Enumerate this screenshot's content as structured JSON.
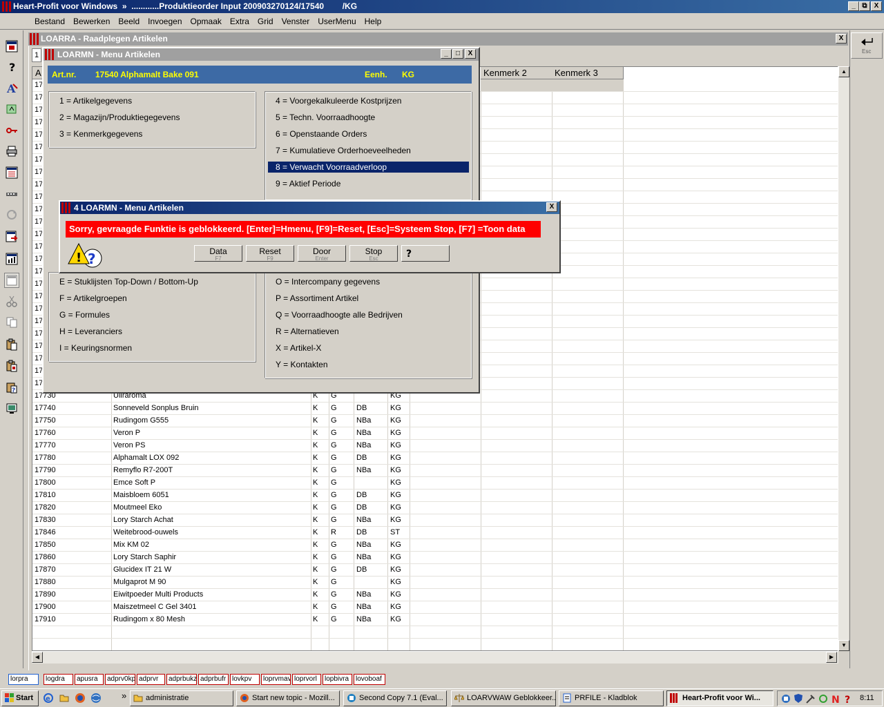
{
  "app": {
    "title": "Heart-Profit voor Windows  »  ............Produktieorder Input 200903270124/17540        /KG",
    "controls": [
      "_",
      "⧉",
      "X"
    ]
  },
  "menubar": [
    "Bestand",
    "Bewerken",
    "Beeld",
    "Invoegen",
    "Opmaak",
    "Extra",
    "Grid",
    "Venster",
    "UserMenu",
    "Help"
  ],
  "esc_label": "Esc",
  "loarra": {
    "title": "LOARRA - Raadplegen Artikelen",
    "close": "X",
    "tab_partial": "1"
  },
  "grid": {
    "columns": [
      {
        "label": "A"
      },
      {
        "label": "Kenmerk 2"
      },
      {
        "label": "Kenmerk 3"
      }
    ],
    "partial_rows": [
      "17",
      "17",
      "17",
      "17",
      "17",
      "17",
      "17",
      "17",
      "17",
      "17",
      "17",
      "17",
      "17",
      "17",
      "17",
      "17",
      "17",
      "17",
      "17",
      "17",
      "17",
      "17",
      "17",
      "17",
      "17"
    ],
    "rows": [
      {
        "code": "17730",
        "desc": "Uliraroma",
        "c1": "K",
        "c2": "G",
        "c3": "",
        "unit": "KG"
      },
      {
        "code": "17740",
        "desc": "Sonneveld Sonplus Bruin",
        "c1": "K",
        "c2": "G",
        "c3": "DB",
        "unit": "KG"
      },
      {
        "code": "17750",
        "desc": "Rudingom G555",
        "c1": "K",
        "c2": "G",
        "c3": "NBa",
        "unit": "KG"
      },
      {
        "code": "17760",
        "desc": "Veron P",
        "c1": "K",
        "c2": "G",
        "c3": "NBa",
        "unit": "KG"
      },
      {
        "code": "17770",
        "desc": "Veron PS",
        "c1": "K",
        "c2": "G",
        "c3": "NBa",
        "unit": "KG"
      },
      {
        "code": "17780",
        "desc": "Alphamalt LOX 092",
        "c1": "K",
        "c2": "G",
        "c3": "DB",
        "unit": "KG"
      },
      {
        "code": "17790",
        "desc": "Remyflo R7-200T",
        "c1": "K",
        "c2": "G",
        "c3": "NBa",
        "unit": "KG"
      },
      {
        "code": "17800",
        "desc": "Emce Soft P",
        "c1": "K",
        "c2": "G",
        "c3": "",
        "unit": "KG"
      },
      {
        "code": "17810",
        "desc": "Maisbloem  6051",
        "c1": "K",
        "c2": "G",
        "c3": "DB",
        "unit": "KG"
      },
      {
        "code": "17820",
        "desc": "Moutmeel Eko",
        "c1": "K",
        "c2": "G",
        "c3": "DB",
        "unit": "KG"
      },
      {
        "code": "17830",
        "desc": "Lory Starch Achat",
        "c1": "K",
        "c2": "G",
        "c3": "NBa",
        "unit": "KG"
      },
      {
        "code": "17846",
        "desc": "Weitebrood-ouwels",
        "c1": "K",
        "c2": "R",
        "c3": "DB",
        "unit": "ST"
      },
      {
        "code": "17850",
        "desc": "Mix KM 02",
        "c1": "K",
        "c2": "G",
        "c3": "NBa",
        "unit": "KG"
      },
      {
        "code": "17860",
        "desc": "Lory Starch Saphir",
        "c1": "K",
        "c2": "G",
        "c3": "NBa",
        "unit": "KG"
      },
      {
        "code": "17870",
        "desc": "Glucidex IT 21 W",
        "c1": "K",
        "c2": "G",
        "c3": "DB",
        "unit": "KG"
      },
      {
        "code": "17880",
        "desc": "Mulgaprot M 90",
        "c1": "K",
        "c2": "G",
        "c3": "",
        "unit": "KG"
      },
      {
        "code": "17890",
        "desc": "Eiwitpoeder Multi Products",
        "c1": "K",
        "c2": "G",
        "c3": "NBa",
        "unit": "KG"
      },
      {
        "code": "17900",
        "desc": "Maiszetmeel C Gel 3401",
        "c1": "K",
        "c2": "G",
        "c3": "NBa",
        "unit": "KG"
      },
      {
        "code": "17910",
        "desc": "Rudingom  x 80 Mesh",
        "c1": "K",
        "c2": "G",
        "c3": "NBa",
        "unit": "KG"
      }
    ]
  },
  "menu_artikelen": {
    "title": "LOARMN - Menu Artikelen",
    "controls": [
      "_",
      "□",
      "X"
    ],
    "art_label": "Art.nr.",
    "art_value": "17540  Alphamalt Bake 091",
    "eenh_label": "Eenh.",
    "eenh_value": "KG",
    "left_top": [
      "1 = Artikelgegevens",
      "2 = Magazijn/Produktiegegevens",
      "3 = Kenmerkgegevens"
    ],
    "right_top": [
      "4 = Voorgekalkuleerde Kostprijzen",
      "5 = Techn. Voorraadhoogte",
      "6 = Openstaande Orders",
      "7 = Kumulatieve Orderhoeveelheden",
      "8 = Verwacht Voorraadverloop",
      "9 = Aktief Periode"
    ],
    "left_bottom": [
      "E = Stuklijsten Top-Down / Bottom-Up",
      "F = Artikelgroepen",
      "G = Formules",
      "H = Leveranciers",
      "I = Keuringsnormen"
    ],
    "right_bottom": [
      "O = Intercompany gegevens",
      "P = Assortiment Artikel",
      "Q = Voorraadhoogte alle Bedrijven",
      "R = Alternatieven",
      "X = Artikel-X",
      "Y = Kontakten"
    ]
  },
  "error_dialog": {
    "title": "4 LOARMN - Menu Artikelen",
    "close": "X",
    "message": "Sorry, gevraagde Funktie is geblokkeerd.  [Enter]=Hmenu, [F9]=Reset, [Esc]=Systeem Stop, [F7] =Toon data",
    "buttons": [
      {
        "label": "Data",
        "key": "F7"
      },
      {
        "label": "Reset",
        "key": "F9"
      },
      {
        "label": "Door",
        "key": "Enter"
      },
      {
        "label": "Stop",
        "key": "Esc"
      },
      {
        "label": "",
        "key": ""
      }
    ]
  },
  "window_tabs": [
    "lorpra",
    "logdra",
    "apusra",
    "adprv0kp",
    "adprvr",
    "adprbukz",
    "adprbufr",
    "lovkpv",
    "loprvmav",
    "loprvorl",
    "lopbivra",
    "lovoboaf"
  ],
  "taskbar": {
    "start": "Start",
    "chevron": "»",
    "tasks": [
      "administratie",
      "Start new topic - Mozill...",
      "Second Copy 7.1 (Eval...",
      "LOARVWAW Geblokkeer...",
      "PRFILE - Kladblok",
      "Heart-Profit voor Wi..."
    ],
    "clock": "8:11"
  }
}
